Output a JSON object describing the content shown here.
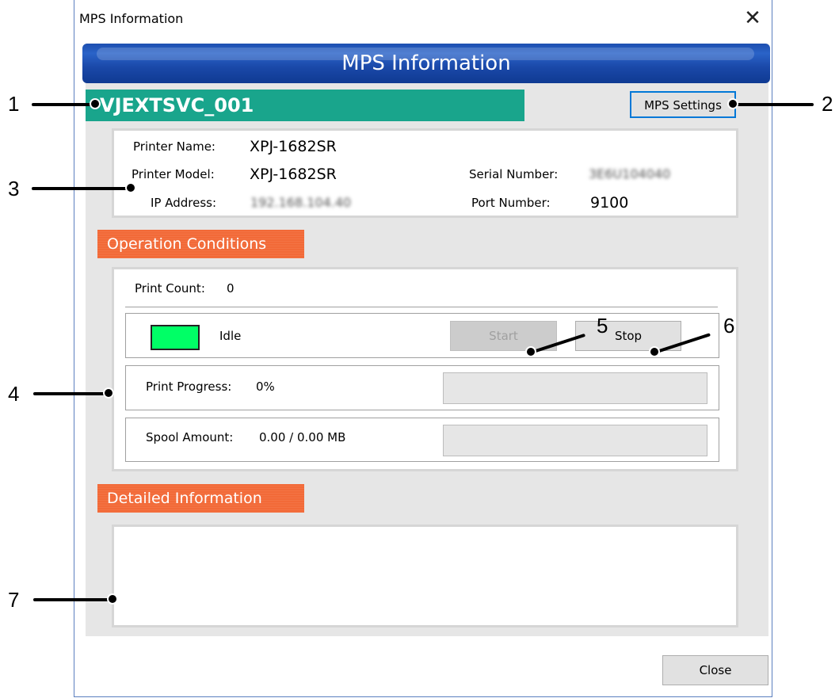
{
  "window": {
    "title": "MPS Information",
    "close_glyph": "✕",
    "close_icon": "close-icon"
  },
  "header": {
    "banner_title": "MPS Information"
  },
  "job": {
    "name": "VJEXTSVC_001",
    "settings_button": "MPS Settings"
  },
  "printer_info": {
    "printer_name_label": "Printer Name:",
    "printer_name": "XPJ-1682SR",
    "printer_model_label": "Printer Model:",
    "printer_model": "XPJ-1682SR",
    "ip_address_label": "IP Address:",
    "ip_address": "192.168.104.40",
    "serial_number_label": "Serial Number:",
    "serial_number": "3E6U104040",
    "port_number_label": "Port Number:",
    "port_number": "9100"
  },
  "operation": {
    "section_title": "Operation Conditions",
    "print_count_label": "Print Count:",
    "print_count": "0",
    "status_text": "Idle",
    "status_color": "#00ff66",
    "start_label": "Start",
    "stop_label": "Stop",
    "print_progress_label": "Print Progress:",
    "print_progress_value": "0%",
    "print_progress_fraction": 0,
    "spool_amount_label": "Spool Amount:",
    "spool_amount_value": "0.00 / 0.00 MB",
    "spool_fraction": 0
  },
  "details": {
    "section_title": "Detailed Information",
    "text": ""
  },
  "footer": {
    "close_label": "Close"
  },
  "callouts": [
    "1",
    "2",
    "3",
    "4",
    "5",
    "6",
    "7"
  ]
}
